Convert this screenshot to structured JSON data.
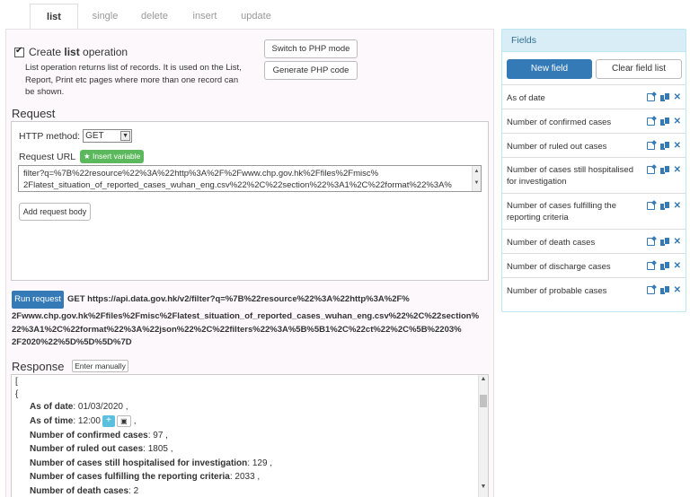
{
  "tabs": [
    {
      "label": "list",
      "active": true
    },
    {
      "label": "single",
      "active": false
    },
    {
      "label": "delete",
      "active": false
    },
    {
      "label": "insert",
      "active": false
    },
    {
      "label": "update",
      "active": false
    }
  ],
  "operation": {
    "checkbox_checked": true,
    "prefix": "Create ",
    "name": "list",
    "suffix": " operation",
    "description": "List operation returns list of records. It is used on the List, Report, Print etc pages where more than one record can be shown."
  },
  "buttons": {
    "switch_php": "Switch to PHP mode",
    "generate_php": "Generate PHP code",
    "add_request_body": "Add request body",
    "run_request": "Run request",
    "enter_manually": "Enter manually",
    "new_field": "New field",
    "clear_field_list": "Clear field list"
  },
  "request": {
    "title": "Request",
    "http_method_label": "HTTP method:",
    "http_method_value": "GET",
    "url_label": "Request URL",
    "insert_variable": "★ Insert variable",
    "url_line1": "filter?q=%7B%22resource%22%3A%22http%3A%2F%2Fwww.chp.gov.hk%2Ffiles%2Fmisc%",
    "url_line2": "2Flatest_situation_of_reported_cases_wuhan_eng.csv%22%2C%22section%22%3A1%2C%22format%22%3A%",
    "get_line1": "GET https://api.data.gov.hk/v2/filter?q=%7B%22resource%22%3A%22http%3A%2F%",
    "get_line2": "2Fwww.chp.gov.hk%2Ffiles%2Fmisc%2Flatest_situation_of_reported_cases_wuhan_eng.csv%22%2C%22section%",
    "get_line3": "22%3A1%2C%22format%22%3A%22json%22%2C%22filters%22%3A%5B%5B1%2C%22ct%22%2C%5B%2203%",
    "get_line4": "2F2020%22%5D%5D%5D%7D"
  },
  "response": {
    "title": "Response",
    "open_bracket": "[",
    "open_brace": "{",
    "lines": [
      {
        "key": "As of date",
        "value": " 01/03/2020 ,"
      },
      {
        "key": "As of time",
        "value": " 12:00"
      },
      {
        "key": "Number of confirmed cases",
        "value": " 97 ,"
      },
      {
        "key": "Number of ruled out cases",
        "value": " 1805 ,"
      },
      {
        "key": "Number of cases still hospitalised for investigation",
        "value": " 129 ,"
      },
      {
        "key": "Number of cases fulfilling the reporting criteria",
        "value": " 2033 ,"
      },
      {
        "key": "Number of death cases",
        "value": " 2"
      }
    ],
    "time_suffix": " ,"
  },
  "fields_panel": {
    "title": "Fields",
    "fields": [
      "As of date",
      "Number of confirmed cases",
      "Number of ruled out cases",
      "Number of cases still hospitalised for investigation",
      "Number of cases fulfilling the reporting criteria",
      "Number of death cases",
      "Number of discharge cases",
      "Number of probable cases"
    ]
  }
}
